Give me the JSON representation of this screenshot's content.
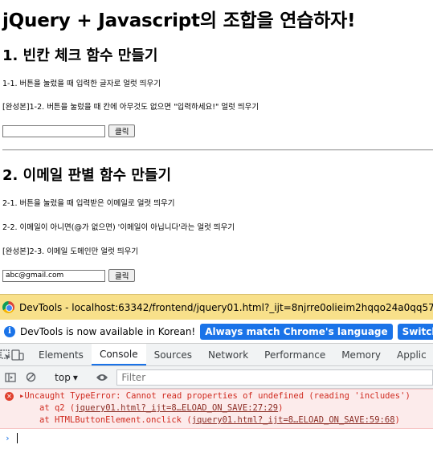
{
  "page": {
    "title": "jQuery + Javascript의 조합을 연습하자!",
    "section1": {
      "heading": "1. 빈칸 체크 함수 만들기",
      "p1": "1-1. 버튼을 눌렀을 때 입력한 글자로 얼럿 띄우기",
      "p2": "[완성본]1-2. 버튼을 눌렀을 때 칸에 아무것도 없으면 \"입력하세요!\" 얼럿 띄우기",
      "input_value": "",
      "button_label": "클릭"
    },
    "section2": {
      "heading": "2. 이메일 판별 함수 만들기",
      "p1": "2-1. 버튼을 눌렀을 때 입력받은 이메일로 얼럿 띄우기",
      "p2": "2-2. 이메일이 아니면(@가 없으면) '이메일이 아닙니다'라는 얼럿 띄우기",
      "p3": "[완성본]2-3. 이메일 도메인만 얼럿 띄우기",
      "input_value": "abc@gmail.com",
      "button_label": "클릭"
    }
  },
  "devtools": {
    "window_title": "DevTools - localhost:63342/frontend/jquery01.html?_ijt=8njrre0olieim2hqqo24a0qq57&_ij_reloa",
    "info_text": "DevTools is now available in Korean!",
    "btn_match": "Always match Chrome's language",
    "btn_switch": "Switch DevTools to Ko",
    "tabs": [
      "Elements",
      "Console",
      "Sources",
      "Network",
      "Performance",
      "Memory",
      "Applic"
    ],
    "active_tab": "Console",
    "context": "top",
    "filter_placeholder": "Filter",
    "error": {
      "line1": "Uncaught TypeError: Cannot read properties of undefined (reading 'includes')",
      "line2_prefix": "at q2 (",
      "line2_link": "jquery01.html?_ijt=8…ELOAD_ON_SAVE:27:29",
      "line2_suffix": ")",
      "line3_prefix": "at HTMLButtonElement.onclick (",
      "line3_link": "jquery01.html?_ijt=8…ELOAD_ON_SAVE:59:68",
      "line3_suffix": ")"
    },
    "icons": [
      "chrome-icon",
      "info-icon",
      "inspect-icon",
      "device-icon",
      "sidebar-icon",
      "clear-icon",
      "eye-icon",
      "error-icon",
      "prompt-icon"
    ],
    "colors": {
      "title_bar": "#f8e08a",
      "accent": "#1a73e8",
      "error_bg": "#fcebeb",
      "error_text": "#d02b20"
    }
  }
}
